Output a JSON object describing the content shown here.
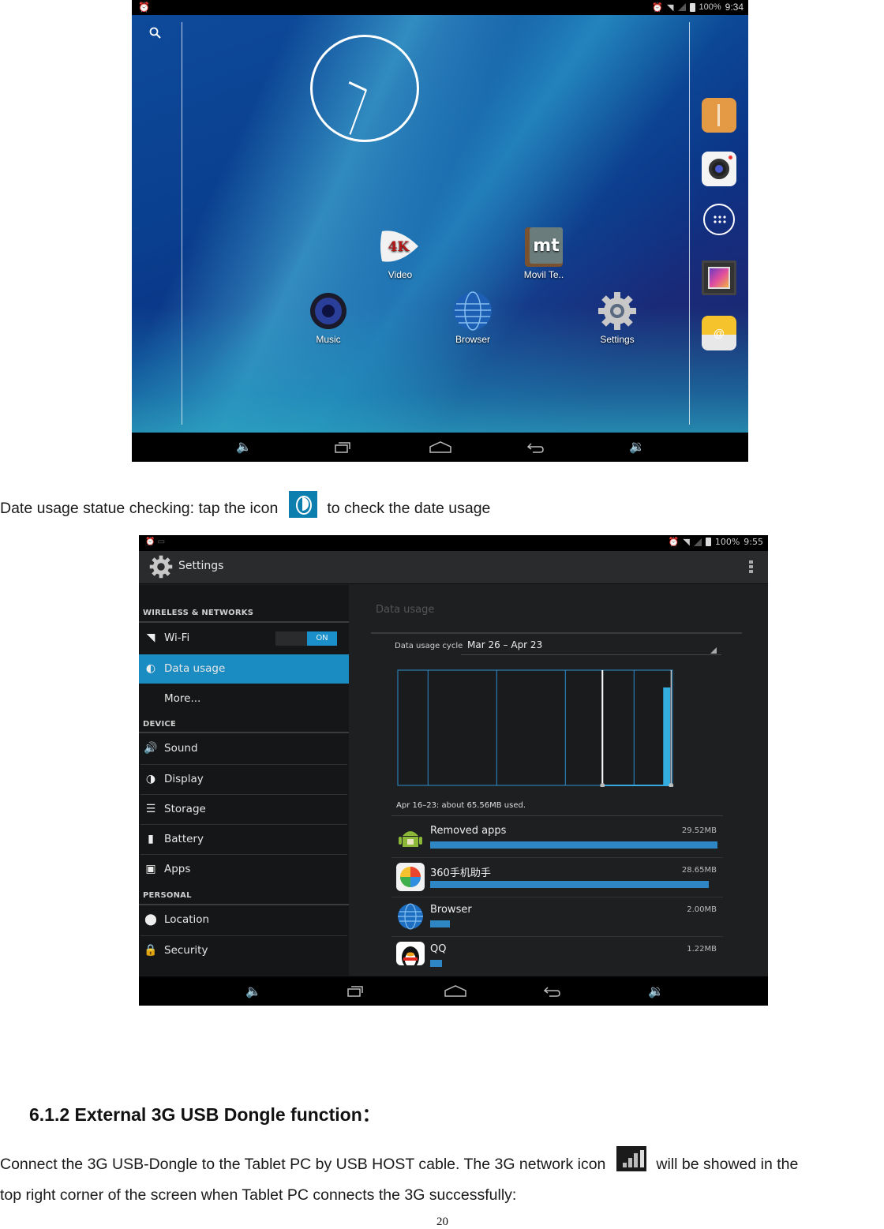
{
  "screenshot_home": {
    "status_bar": {
      "battery": "100%",
      "time": "9:34"
    },
    "apps": [
      {
        "label": "Video",
        "icon": "video-4k-icon"
      },
      {
        "label": "Movil Te..",
        "icon": "movil-te-icon"
      },
      {
        "label": "Music",
        "icon": "music-speaker-icon"
      },
      {
        "label": "Browser",
        "icon": "globe-icon"
      },
      {
        "label": "Settings",
        "icon": "gear-icon"
      }
    ],
    "dock": [
      "file-manager-icon",
      "camera-icon",
      "app-drawer-icon",
      "gallery-icon",
      "email-icon"
    ],
    "icon_4k_text": "4K",
    "icon_mt_text": "mt",
    "clock": {
      "hour": 10,
      "minute": 34
    }
  },
  "text": {
    "data_usage_line_before": "Date usage statue checking: tap the icon",
    "data_usage_line_after": "to check the date usage",
    "heading": "6.1.2 External 3G USB Dongle function：",
    "dongle_line1_before": "Connect the 3G USB-Dongle to the Tablet PC by USB HOST cable. The 3G network icon",
    "dongle_line1_after": "will be showed in the",
    "dongle_line2": "top right corner of the screen when Tablet PC connects the 3G successfully:",
    "page_number": "20"
  },
  "screenshot_settings": {
    "status_bar": {
      "battery": "100%",
      "time": "9:55"
    },
    "title": "Settings",
    "sections": {
      "wireless": "WIRELESS & NETWORKS",
      "device": "DEVICE",
      "personal": "PERSONAL"
    },
    "items": {
      "wifi": "Wi-Fi",
      "wifi_toggle": "ON",
      "data_usage": "Data usage",
      "more": "More...",
      "sound": "Sound",
      "display": "Display",
      "storage": "Storage",
      "battery": "Battery",
      "apps": "Apps",
      "location": "Location",
      "security": "Security"
    },
    "data_usage": {
      "title": "Data usage",
      "cycle_label": "Data usage cycle",
      "cycle_value": "Mar 26 – Apr 23",
      "summary": "Apr 16–23: about 65.56MB used.",
      "chart_fraction_usage_bar": 0.85,
      "app_usage": [
        {
          "name": "Removed apps",
          "size": "29.52MB",
          "fraction": 1.0
        },
        {
          "name": "360手机助手",
          "size": "28.65MB",
          "fraction": 0.97
        },
        {
          "name": "Browser",
          "size": "2.00MB",
          "fraction": 0.068
        },
        {
          "name": "QQ",
          "size": "1.22MB",
          "fraction": 0.041
        }
      ]
    }
  }
}
